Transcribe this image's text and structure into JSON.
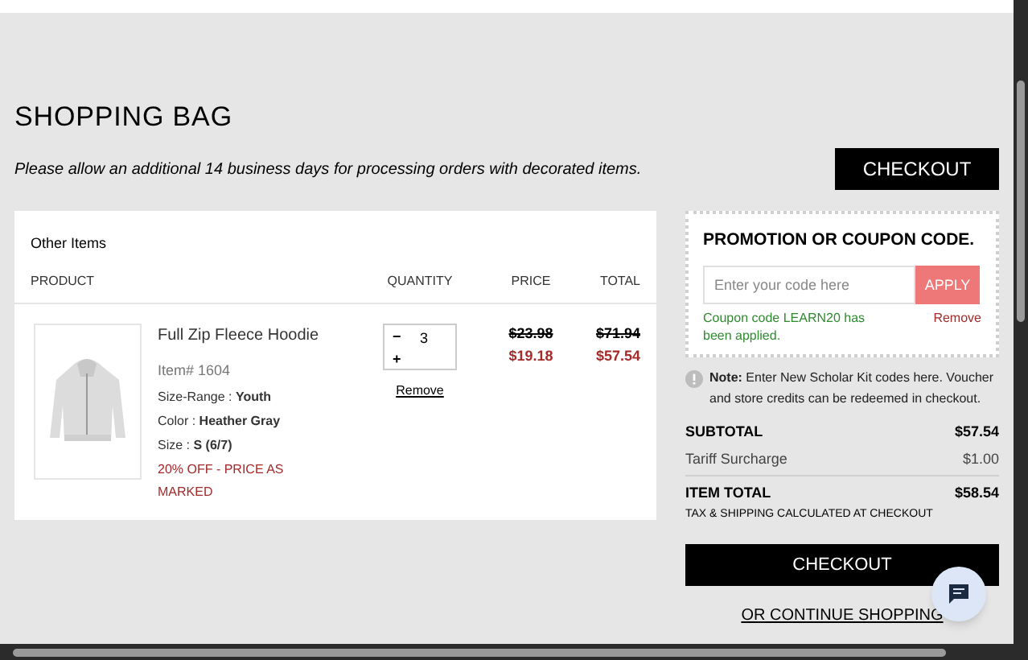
{
  "page": {
    "title": "SHOPPING BAG",
    "notice": "Please allow an additional 14 business days for processing orders with decorated items.",
    "checkout_top": "CHECKOUT"
  },
  "cart": {
    "section_title": "Other Items",
    "columns": [
      "PRODUCT",
      "QUANTITY",
      "PRICE",
      "TOTAL"
    ],
    "items": [
      {
        "kind": "picture",
        "name": "Full Zip Fleece Hoodie",
        "item_no": "Item# 1604",
        "attributes": [
          "Size-Range : **Youth**",
          "Color : **Heather Gray**",
          "Size : **S (6/7)**"
        ],
        "promo": "20% OFF - PRICE AS MARKED",
        "decrement": "−",
        "quantity": "3",
        "increment": "+",
        "remove": "Remove",
        "old_price": "$23.98",
        "price": "$19.18",
        "old_total": "$71.94",
        "total": "$57.54"
      }
    ]
  },
  "promotion": {
    "title": "PROMOTION OR COUPON CODE.",
    "placeholder": "Enter your code here",
    "apply": "APPLY",
    "applied_message": "Coupon code LEARN20 has been applied.",
    "remove": "Remove"
  },
  "note": {
    "text": "**Note:** Enter New Scholar Kit codes here. Voucher and store credits can be redeemed in checkout."
  },
  "summary": {
    "subtotal_label": "SUBTOTAL",
    "subtotal": "$57.54",
    "surcharge_label": "Tariff Surcharge",
    "surcharge": "$1.00",
    "total_label": "ITEM TOTAL",
    "total": "$58.54",
    "tax_note": "TAX & SHIPPING CALCULATED AT CHECKOUT",
    "checkout": "CHECKOUT",
    "continue": "OR CONTINUE SHOPPING"
  }
}
